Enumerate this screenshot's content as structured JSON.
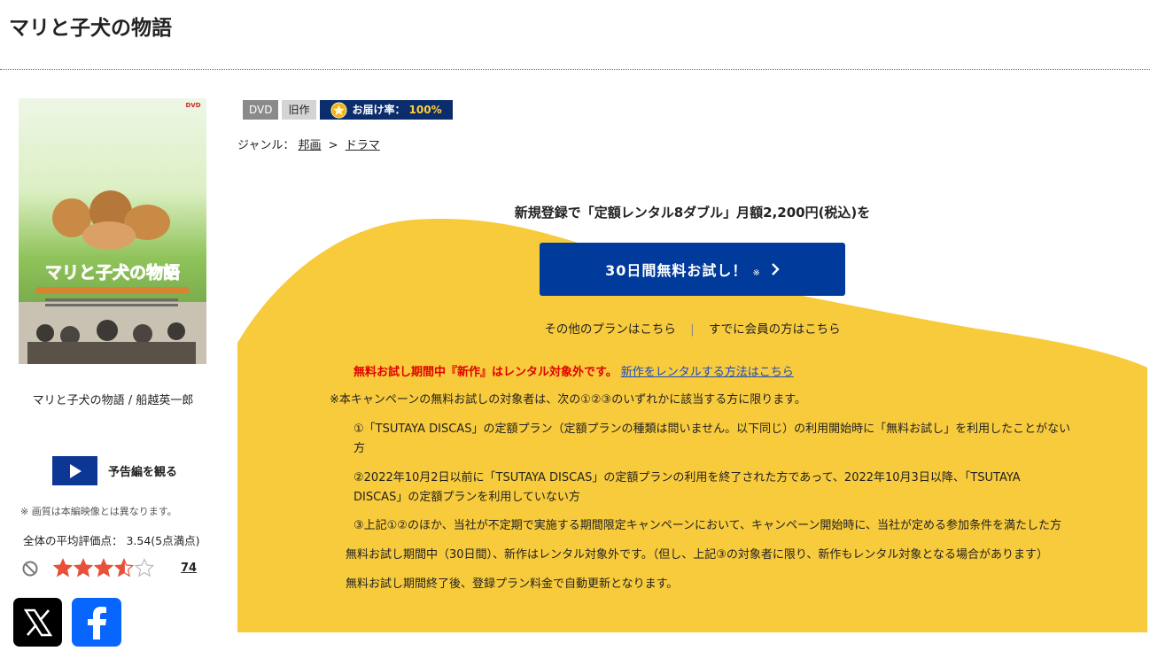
{
  "title": "マリと子犬の物語",
  "cover": {
    "alt": "マリと子犬の物語",
    "title_text": "マリと子犬の物語",
    "corner_tag": "DVD"
  },
  "caption": "マリと子犬の物語 / 船越英一郎",
  "trailer": {
    "label": "予告編を観る"
  },
  "note": "※ 画質は本編映像とは異なります。",
  "rating": {
    "summary": "全体の平均評価点： 3.54(5点満点)",
    "score": 3.54,
    "max": 5,
    "count": "74"
  },
  "badges": {
    "format": "DVD",
    "release": "旧作",
    "delivery_label": "お届け率：",
    "delivery_rate": "100%"
  },
  "genre": {
    "label": "ジャンル：",
    "items": [
      "邦画",
      "ドラマ"
    ],
    "separator": ">"
  },
  "promo": {
    "headline": "新規登録で「定額レンタル8ダブル」月額2,200円(税込)を",
    "trial_button": "30日間無料お試し！",
    "trial_mark": "※",
    "link_other_plans": "その他のプランはこちら",
    "separator": "|",
    "link_members": "すでに会員の方はこちら",
    "warning": "無料お試し期間中『新作』はレンタル対象外です。",
    "warning_link": "新作をレンタルする方法はこちら",
    "conditions_intro": "※本キャンペーンの無料お試しの対象者は、次の①②③のいずれかに該当する方に限ります。",
    "cond1_line1": "①「TSUTAYA DISCAS」の定額プラン（定額プランの種類は問いません。以下同じ）の利用開始時に「無料お試し」を利用したことがない",
    "cond1_line2": "方",
    "cond2_line1": "②2022年10月2日以前に「TSUTAYA DISCAS」の定額プランの利用を終了された方であって、2022年10月3日以降、「TSUTAYA",
    "cond2_line2": "DISCAS」の定額プランを利用していない方",
    "cond3": "③上記①②のほか、当社が不定期で実施する期間限定キャンペーンにおいて、キャンペーン開始時に、当社が定める参加条件を満たした方",
    "trial_period_note": "無料お試し期間中（30日間）、新作はレンタル対象外です。（但し、上記③の対象者に限り、新作もレンタル対象となる場合があります）",
    "renewal_note": "無料お試し期間終了後、登録プラン料金で自動更新となります。"
  },
  "colors": {
    "promo_bg": "#f8cb3c",
    "primary_blue": "#003a9b",
    "warning_red": "#e00000",
    "star": "#e8503a"
  },
  "icons": {
    "play": "play-icon",
    "no": "no-entry-icon",
    "x": "x-logo-icon",
    "facebook": "facebook-logo-icon",
    "chevron": "chevron-right-icon",
    "medal": "star-medal-icon"
  }
}
